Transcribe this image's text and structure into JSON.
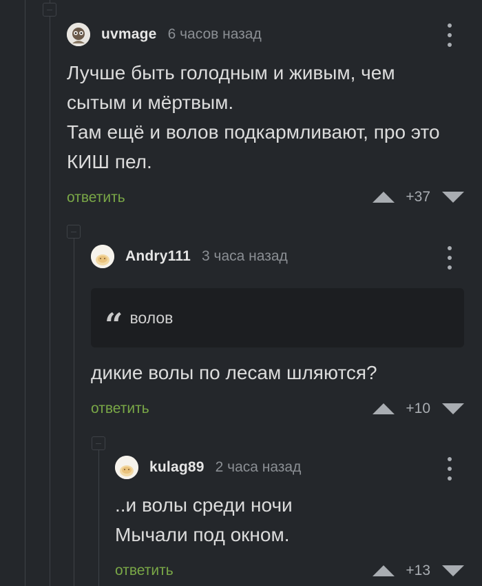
{
  "comments": [
    {
      "username": "uvmage",
      "time": "6 часов назад",
      "text_lines": [
        "Лучше быть голодным и живым, чем",
        "сытым и мёртвым.",
        "Там ещё и волов подкармливают, про это",
        "КИШ пел."
      ],
      "reply_label": "ответить",
      "score": "+37"
    },
    {
      "username": "Andry111",
      "time": "3 часа назад",
      "quote": "волов",
      "text_lines": [
        "дикие волы по лесам шляются?"
      ],
      "reply_label": "ответить",
      "score": "+10"
    },
    {
      "username": "kulag89",
      "time": "2 часа назад",
      "text_lines": [
        "..и волы среди ночи",
        "Мычали под окном."
      ],
      "reply_label": "ответить",
      "score": "+13"
    }
  ],
  "icons": {
    "more": "more-vertical-icon",
    "quote": "quote-icon",
    "upvote": "triangle-up-icon",
    "downvote": "triangle-down-icon",
    "collapse": "collapse-minus-icon"
  },
  "colors": {
    "background": "#24272b",
    "reply_link": "#7aa847",
    "muted": "#8b8f94"
  }
}
